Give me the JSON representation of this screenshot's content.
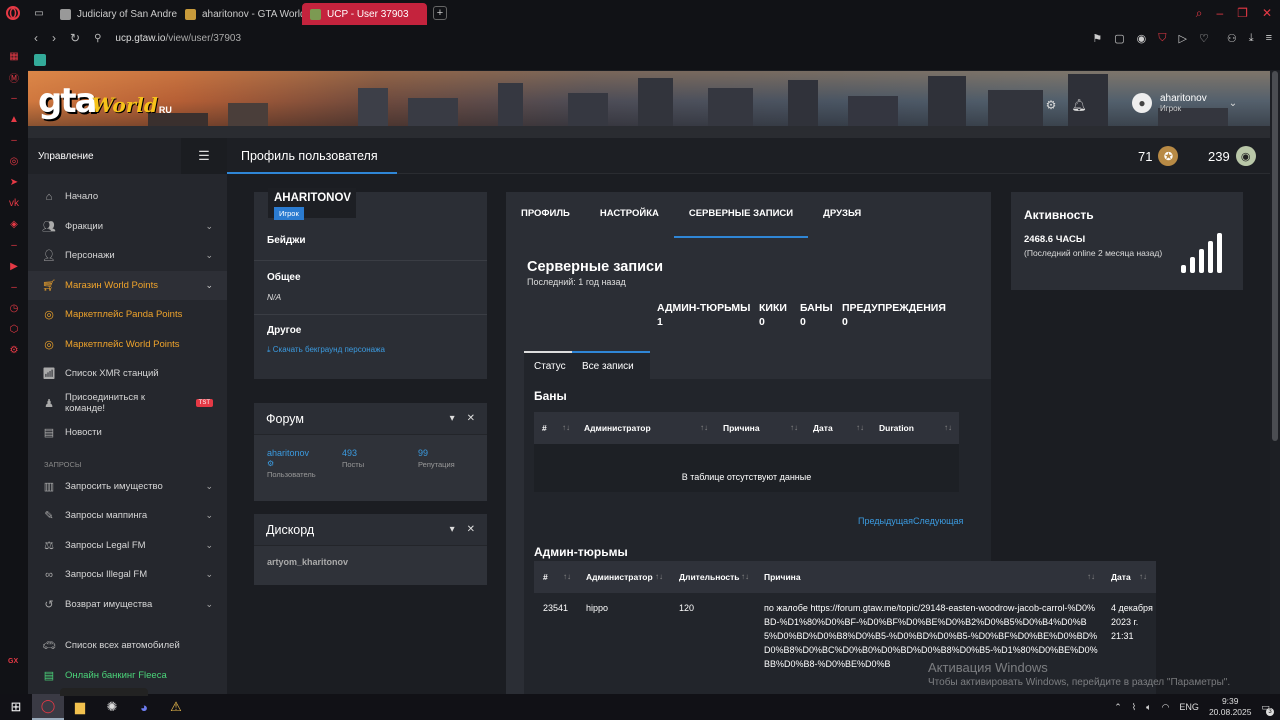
{
  "browser": {
    "tabs": [
      {
        "label": "Judiciary of San Andreas"
      },
      {
        "label": "aharitonov - GTA World R"
      },
      {
        "label": "UCP - User 37903"
      }
    ],
    "url_host": "ucp.gtaw.io",
    "url_path": "/view/user/37903"
  },
  "header": {
    "logo_gta": "gta",
    "logo_world": "World",
    "logo_ru": "RU",
    "username": "aharitonov",
    "role": "Игрок"
  },
  "nav": {
    "title": "Управление",
    "items": [
      {
        "label": "Начало",
        "icon": "home-icon"
      },
      {
        "label": "Фракции",
        "icon": "users-icon"
      },
      {
        "label": "Персонажи",
        "icon": "user-icon"
      },
      {
        "label": "Магазин World Points",
        "icon": "cart-icon"
      },
      {
        "label": "Маркетплейс Panda Points",
        "icon": "coins-icon"
      },
      {
        "label": "Маркетплейс World Points",
        "icon": "coins-icon"
      },
      {
        "label": "Список XMR станций",
        "icon": "antenna-icon"
      },
      {
        "label": "Присоединиться к команде!",
        "icon": "team-icon",
        "badge": "TST"
      },
      {
        "label": "Новости",
        "icon": "news-icon"
      }
    ],
    "section": "ЗАПРОСЫ",
    "requests": [
      {
        "label": "Запросить имущество"
      },
      {
        "label": "Запросы маппинга"
      },
      {
        "label": "Запросы Legal FM"
      },
      {
        "label": "Запросы Illegal FM"
      },
      {
        "label": "Возврат имущества"
      },
      {
        "label": "Список всех автомобилей"
      },
      {
        "label": "Онлайн банкинг Fleeca"
      }
    ]
  },
  "titlebar": {
    "title": "Профиль пользователя",
    "stat1": "71",
    "stat2": "239"
  },
  "profile": {
    "username": "AHARITONOV",
    "role": "Игрок",
    "badges_label": "Бейджи",
    "general_label": "Общее",
    "general_value": "N/A",
    "other_label": "Другое",
    "download_link": "Скачать бекграунд персонажа"
  },
  "forum": {
    "title": "Форум",
    "user": "aharitonov",
    "user_sub": "Пользователь",
    "posts": "493",
    "posts_label": "Посты",
    "rep": "99",
    "rep_label": "Репутация"
  },
  "discord": {
    "title": "Дискорд",
    "handle": "artyom_kharitonov"
  },
  "center": {
    "tabs": [
      "ПРОФИЛЬ",
      "НАСТРОЙКА",
      "СЕРВЕРНЫЕ ЗАПИСИ",
      "ДРУЗЬЯ"
    ],
    "title": "Серверные записи",
    "last": "Последний: 1 год назад",
    "counts": [
      {
        "label": "АДМИН-ТЮРЬМЫ",
        "value": "1"
      },
      {
        "label": "КИКИ",
        "value": "0"
      },
      {
        "label": "БАНЫ",
        "value": "0"
      },
      {
        "label": "ПРЕДУПРЕЖДЕНИЯ",
        "value": "0"
      }
    ],
    "subtabs": [
      "Статус",
      "Все записи"
    ],
    "bans_title": "Баны",
    "bans_headers": [
      "#",
      "Администратор",
      "Причина",
      "Дата",
      "Duration"
    ],
    "bans_empty": "В таблице отсутствуют данные",
    "prev": "Предыдущая",
    "next": "Следующая",
    "jail_title": "Админ-тюрьмы",
    "jail_headers": [
      "#",
      "Администратор",
      "Длительность",
      "Причина",
      "Дата"
    ],
    "jail_rows": [
      {
        "id": "23541",
        "admin": "hippo",
        "duration": "120",
        "reason": "по жалобе https://forum.gtaw.me/topic/29148-easten-woodrow-jacob-carrol-%D0%BD-%D1%80%D0%BF-%D0%BF%D0%BE%D0%B2%D0%B5%D0%B4%D0%B5%D0%BD%D0%B8%D0%B5-%D0%BD%D0%B5-%D0%BF%D0%BE%D0%BD%D0%B8%D0%BC%D0%B0%D0%BD%D0%B8%D0%B5-%D1%80%D0%BE%D0%BB%D0%B8-%D0%BE%D0%B",
        "date": "4 декабря 2023 г. 21:31"
      }
    ]
  },
  "activity": {
    "title": "Активность",
    "hours": "2468.6 ЧАСЫ",
    "last_online": "(Последний online 2 месяца назад)"
  },
  "windows": {
    "activation_title": "Активация Windows",
    "activation_text": "Чтобы активировать Windows, перейдите в раздел \"Параметры\"."
  },
  "taskbar": {
    "lang": "ENG",
    "time": "9:39",
    "date": "20.08.2025",
    "notif": "3"
  }
}
